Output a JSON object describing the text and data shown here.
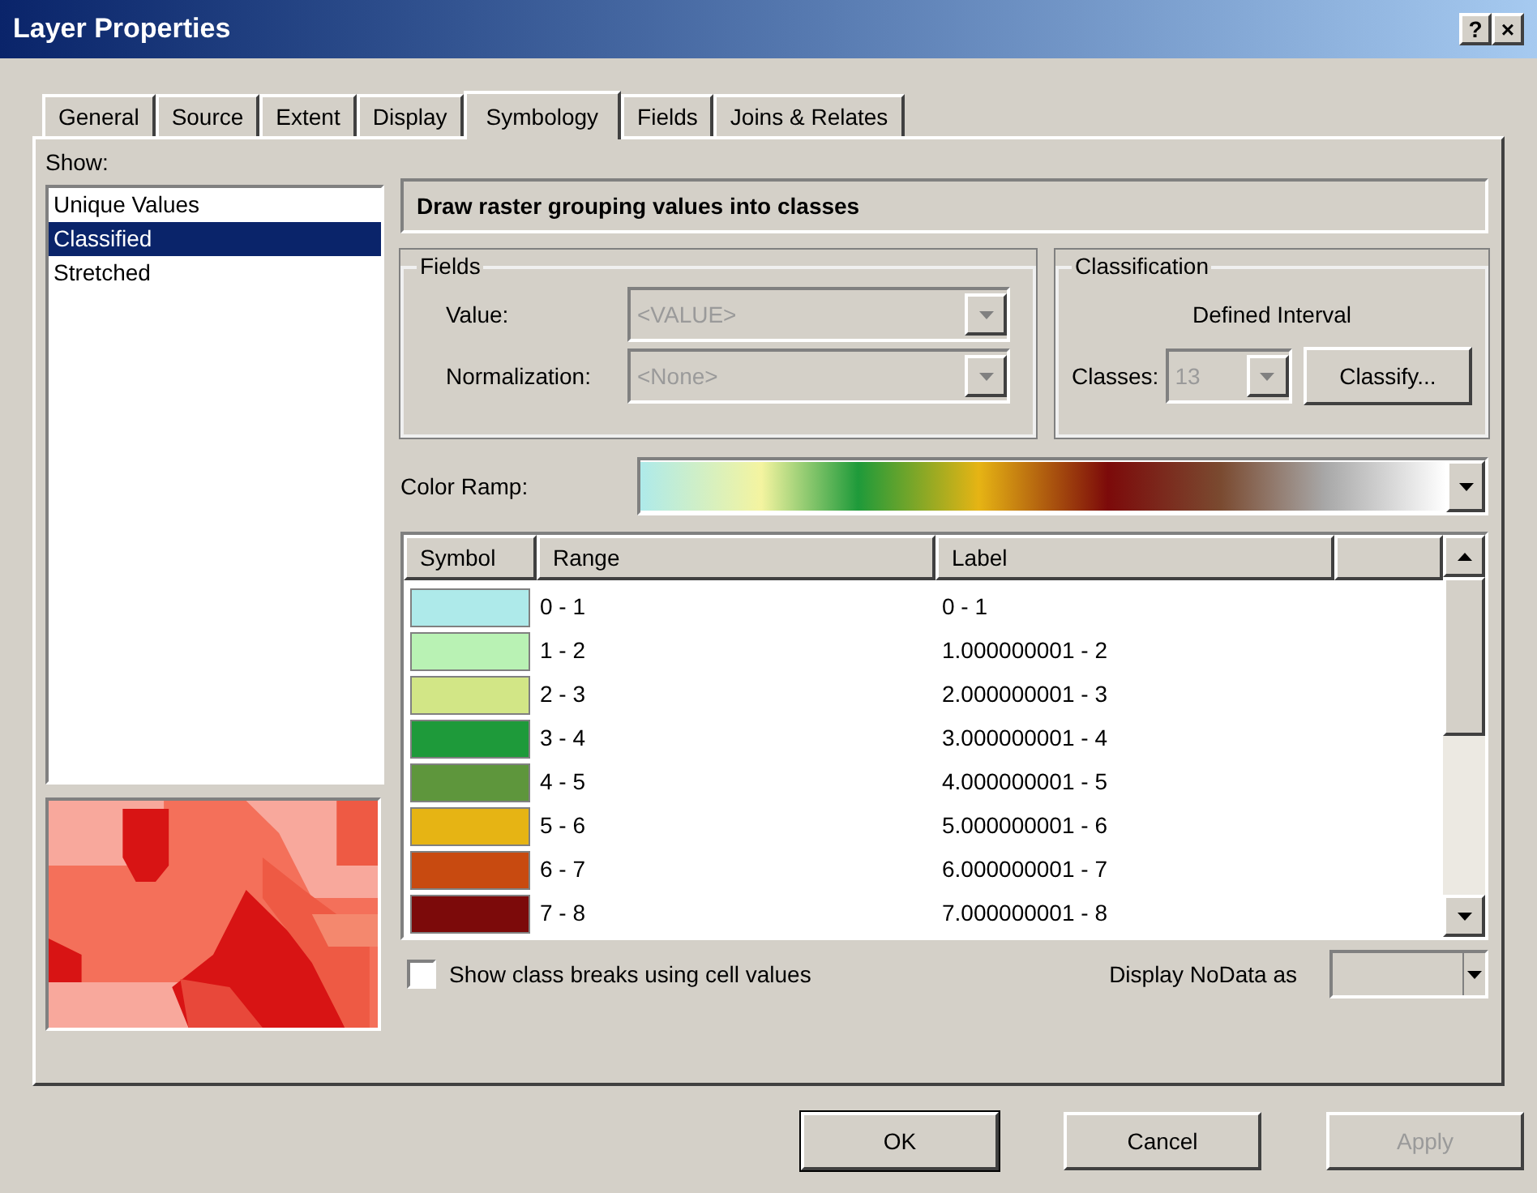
{
  "window": {
    "title": "Layer Properties",
    "title_buttons": [
      "?",
      "×"
    ]
  },
  "tabs": [
    {
      "label": "General",
      "selected": false
    },
    {
      "label": "Source",
      "selected": false
    },
    {
      "label": "Extent",
      "selected": false
    },
    {
      "label": "Display",
      "selected": false
    },
    {
      "label": "Symbology",
      "selected": true
    },
    {
      "label": "Fields",
      "selected": false
    },
    {
      "label": "Joins & Relates",
      "selected": false
    }
  ],
  "show": {
    "label": "Show:",
    "items": [
      {
        "label": "Unique Values",
        "selected": false
      },
      {
        "label": "Classified",
        "selected": true
      },
      {
        "label": "Stretched",
        "selected": false
      }
    ]
  },
  "description": "Draw raster grouping values into classes",
  "fields": {
    "title": "Fields",
    "rows": [
      {
        "label": "Value:",
        "value": "<VALUE>",
        "disabled": true
      },
      {
        "label": "Normalization:",
        "value": "<None>",
        "disabled": true
      }
    ]
  },
  "classification": {
    "title": "Classification",
    "method": "Defined Interval",
    "classes_label": "Classes:",
    "classes_value": "13",
    "classes_disabled": true,
    "classify_button": "Classify..."
  },
  "color_ramp": {
    "label": "Color Ramp:"
  },
  "table": {
    "columns": [
      "Symbol",
      "Range",
      "Label"
    ],
    "rows": [
      {
        "color": "#aeeaea",
        "range": "0 - 1",
        "label": "0 - 1"
      },
      {
        "color": "#b9f2b4",
        "range": "1 - 2",
        "label": "1.000000001 - 2"
      },
      {
        "color": "#d2e686",
        "range": "2 - 3",
        "label": "2.000000001 - 3"
      },
      {
        "color": "#1e9a3a",
        "range": "3 - 4",
        "label": "3.000000001 - 4"
      },
      {
        "color": "#5e963c",
        "range": "4 - 5",
        "label": "4.000000001 - 5"
      },
      {
        "color": "#e6b414",
        "range": "5 - 6",
        "label": "5.000000001 - 6"
      },
      {
        "color": "#c84a10",
        "range": "6 - 7",
        "label": "6.000000001 - 7"
      },
      {
        "color": "#7c0a0a",
        "range": "7 - 8",
        "label": "7.000000001 - 8"
      }
    ]
  },
  "show_class_breaks": {
    "label": "Show class breaks using cell values",
    "checked": false
  },
  "nodata": {
    "label": "Display NoData as"
  },
  "buttons": [
    {
      "label": "OK",
      "disabled": false,
      "default": true
    },
    {
      "label": "Cancel",
      "disabled": false,
      "default": false
    },
    {
      "label": "Apply",
      "disabled": true,
      "default": false
    }
  ]
}
